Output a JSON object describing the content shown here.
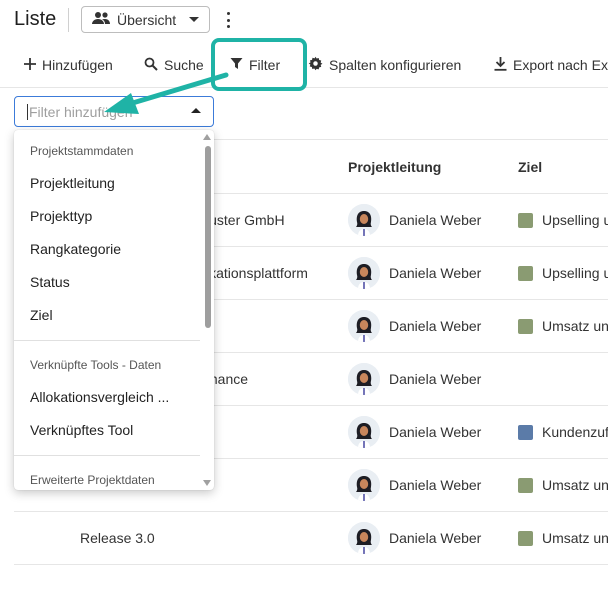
{
  "header": {
    "title": "Liste",
    "view_label": "Übersicht"
  },
  "toolbar": {
    "add_label": "Hinzufügen",
    "search_label": "Suche",
    "filter_label": "Filter",
    "columns_label": "Spalten konfigurieren",
    "export_label": "Export nach Ex"
  },
  "filter": {
    "placeholder": "Filter hinzufügen"
  },
  "table": {
    "headers": {
      "lead": "Projektleitung",
      "goal": "Ziel"
    },
    "rows": [
      {
        "name": "luster GmbH",
        "lead": "Daniela Weber",
        "goal": "Upselling u",
        "goal_color": "#8a9b72"
      },
      {
        "name": "ikationsplattform",
        "lead": "Daniela Weber",
        "goal": "Upselling u",
        "goal_color": "#8a9b72"
      },
      {
        "name": "",
        "lead": "Daniela Weber",
        "goal": "Umsatz un",
        "goal_color": "#8a9b72"
      },
      {
        "name": "mance",
        "lead": "Daniela Weber",
        "goal": "",
        "goal_color": ""
      },
      {
        "name": "",
        "lead": "Daniela Weber",
        "goal": "Kundenzuf",
        "goal_color": "#5b7ba8"
      },
      {
        "name": "",
        "lead": "Daniela Weber",
        "goal": "Umsatz un",
        "goal_color": "#8a9b72"
      },
      {
        "name": "Release 3.0",
        "lead": "Daniela Weber",
        "goal": "Umsatz un",
        "goal_color": "#8a9b72"
      }
    ]
  },
  "dropdown": {
    "groups": [
      {
        "label": "Projektstammdaten",
        "items": [
          "Projektleitung",
          "Projekttyp",
          "Rangkategorie",
          "Status",
          "Ziel"
        ]
      },
      {
        "label": "Verknüpfte Tools - Daten",
        "items": [
          "Allokationsvergleich ...",
          "Verknüpftes Tool"
        ]
      },
      {
        "label": "Erweiterte Projektdaten",
        "items": []
      }
    ]
  },
  "colors": {
    "accent": "#3c7bd9",
    "highlight": "#1fb3a6",
    "goal_green": "#8a9b72",
    "goal_blue": "#5b7ba8"
  },
  "icons": [
    "people-icon",
    "caret-down-icon",
    "more-vert-icon",
    "plus-icon",
    "search-icon",
    "filter-icon",
    "gear-icon",
    "download-icon",
    "caret-up-icon",
    "avatar-icon"
  ]
}
